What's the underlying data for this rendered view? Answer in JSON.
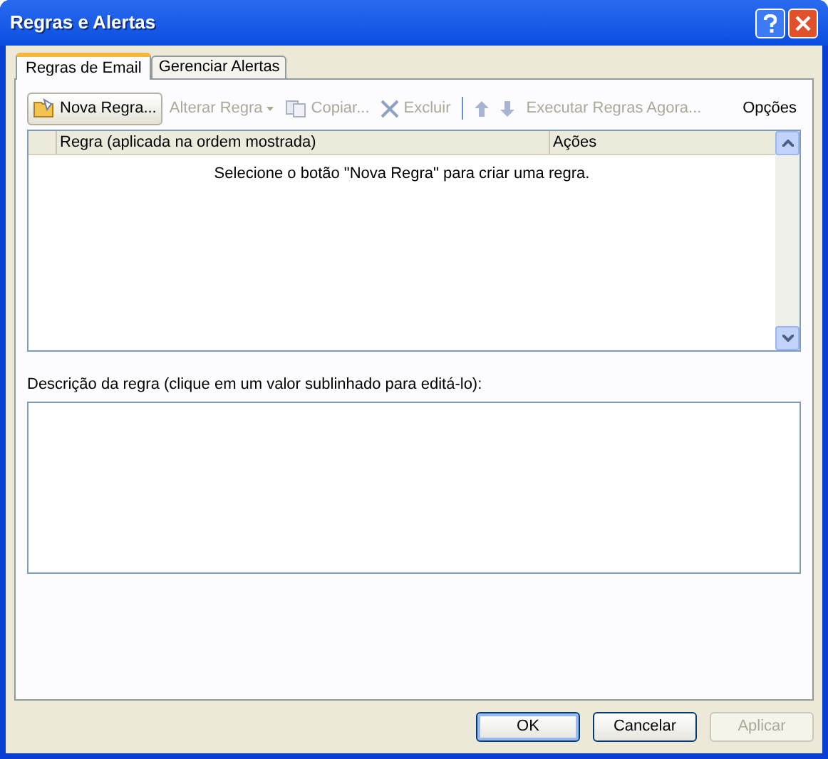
{
  "window": {
    "title": "Regras e Alertas"
  },
  "tabs": [
    {
      "label": "Regras de Email",
      "selected": true
    },
    {
      "label": "Gerenciar Alertas",
      "selected": false
    }
  ],
  "toolbar": [
    {
      "label": "Nova Regra...",
      "disabled": false,
      "boxed": true,
      "has_menu": false
    },
    {
      "label": "Alterar Regra",
      "disabled": true,
      "boxed": false,
      "has_menu": true
    },
    {
      "label": "Copiar...",
      "disabled": true,
      "boxed": false,
      "has_menu": false
    },
    {
      "label": "Excluir",
      "disabled": true,
      "boxed": false,
      "has_menu": false
    },
    {
      "disabled": true,
      "boxed": false,
      "has_menu": false
    },
    {
      "disabled": true,
      "boxed": false,
      "has_menu": false
    },
    {
      "label": "Executar Regras Agora...",
      "disabled": true,
      "boxed": false,
      "has_menu": false
    },
    {
      "label": "Opções",
      "disabled": false,
      "boxed": false,
      "has_menu": false
    }
  ],
  "rules_table": {
    "columns": [
      "Regra (aplicada na ordem mostrada)",
      "Ações"
    ],
    "empty_message": "Selecione o botão \"Nova Regra\" para criar uma regra."
  },
  "description": {
    "label": "Descrição da regra (clique em um valor sublinhado para editá-lo):"
  },
  "buttons": [
    {
      "label": "OK",
      "disabled": false,
      "default": true
    },
    {
      "label": "Cancelar",
      "disabled": false,
      "default": false
    },
    {
      "label": "Aplicar",
      "disabled": true,
      "default": false
    }
  ]
}
